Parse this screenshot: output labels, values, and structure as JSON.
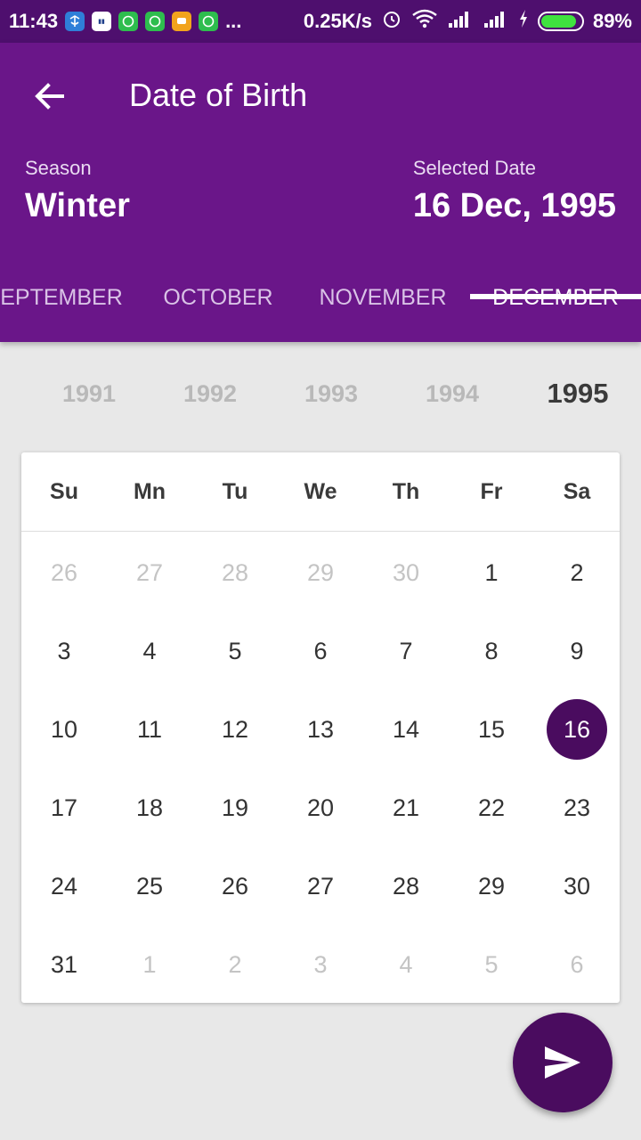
{
  "status_bar": {
    "time": "11:43",
    "speed": "0.25K/s",
    "battery": "89%",
    "more": "..."
  },
  "toolbar": {
    "title": "Date of Birth"
  },
  "season": {
    "label": "Season",
    "value": "Winter"
  },
  "selected": {
    "label": "Selected Date",
    "value": "16 Dec, 1995"
  },
  "months": [
    "EPTEMBER",
    "OCTOBER",
    "NOVEMBER",
    "DECEMBER"
  ],
  "active_month": "DECEMBER",
  "years": [
    "1991",
    "1992",
    "1993",
    "1994",
    "1995"
  ],
  "active_year": "1995",
  "weekdays": [
    "Su",
    "Mn",
    "Tu",
    "We",
    "Th",
    "Fr",
    "Sa"
  ],
  "weeks": [
    [
      {
        "d": "26",
        "m": true
      },
      {
        "d": "27",
        "m": true
      },
      {
        "d": "28",
        "m": true
      },
      {
        "d": "29",
        "m": true
      },
      {
        "d": "30",
        "m": true
      },
      {
        "d": "1"
      },
      {
        "d": "2"
      }
    ],
    [
      {
        "d": "3"
      },
      {
        "d": "4"
      },
      {
        "d": "5"
      },
      {
        "d": "6"
      },
      {
        "d": "7"
      },
      {
        "d": "8"
      },
      {
        "d": "9"
      }
    ],
    [
      {
        "d": "10"
      },
      {
        "d": "11"
      },
      {
        "d": "12"
      },
      {
        "d": "13"
      },
      {
        "d": "14"
      },
      {
        "d": "15"
      },
      {
        "d": "16",
        "sel": true
      }
    ],
    [
      {
        "d": "17"
      },
      {
        "d": "18"
      },
      {
        "d": "19"
      },
      {
        "d": "20"
      },
      {
        "d": "21"
      },
      {
        "d": "22"
      },
      {
        "d": "23"
      }
    ],
    [
      {
        "d": "24"
      },
      {
        "d": "25"
      },
      {
        "d": "26"
      },
      {
        "d": "27"
      },
      {
        "d": "28"
      },
      {
        "d": "29"
      },
      {
        "d": "30"
      }
    ],
    [
      {
        "d": "31"
      },
      {
        "d": "1",
        "m": true
      },
      {
        "d": "2",
        "m": true
      },
      {
        "d": "3",
        "m": true
      },
      {
        "d": "4",
        "m": true
      },
      {
        "d": "5",
        "m": true
      },
      {
        "d": "6",
        "m": true
      }
    ]
  ],
  "colors": {
    "primary": "#6a1689",
    "status_bar": "#4e0f6e",
    "accent": "#4a0c5f"
  },
  "icons": {
    "back": "arrow-back-icon",
    "fab": "send-icon"
  }
}
